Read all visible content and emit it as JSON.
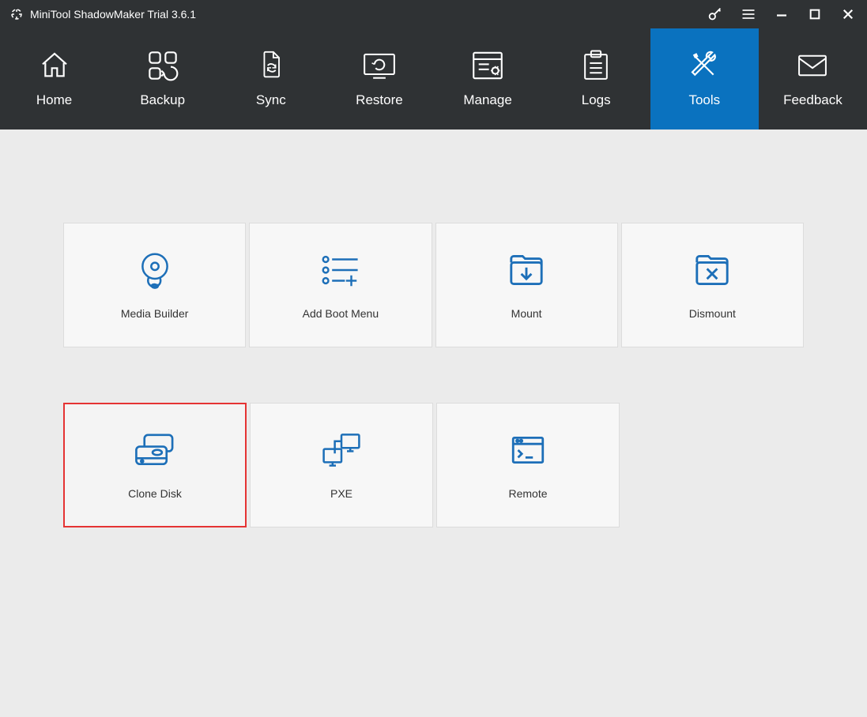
{
  "title": "MiniTool ShadowMaker Trial 3.6.1",
  "nav": [
    {
      "label": "Home"
    },
    {
      "label": "Backup"
    },
    {
      "label": "Sync"
    },
    {
      "label": "Restore"
    },
    {
      "label": "Manage"
    },
    {
      "label": "Logs"
    },
    {
      "label": "Tools"
    },
    {
      "label": "Feedback"
    }
  ],
  "active_nav": "Tools",
  "tools_row1": [
    {
      "label": "Media Builder"
    },
    {
      "label": "Add Boot Menu"
    },
    {
      "label": "Mount"
    },
    {
      "label": "Dismount"
    }
  ],
  "tools_row2": [
    {
      "label": "Clone Disk"
    },
    {
      "label": "PXE"
    },
    {
      "label": "Remote"
    }
  ],
  "highlighted_tool": "Clone Disk",
  "colors": {
    "titlebar_bg": "#2f3234",
    "accent": "#0a72bf",
    "icon_blue": "#1d6fb8",
    "highlight": "#e53333",
    "content_bg": "#ebebeb",
    "card_bg": "#f7f7f7"
  }
}
